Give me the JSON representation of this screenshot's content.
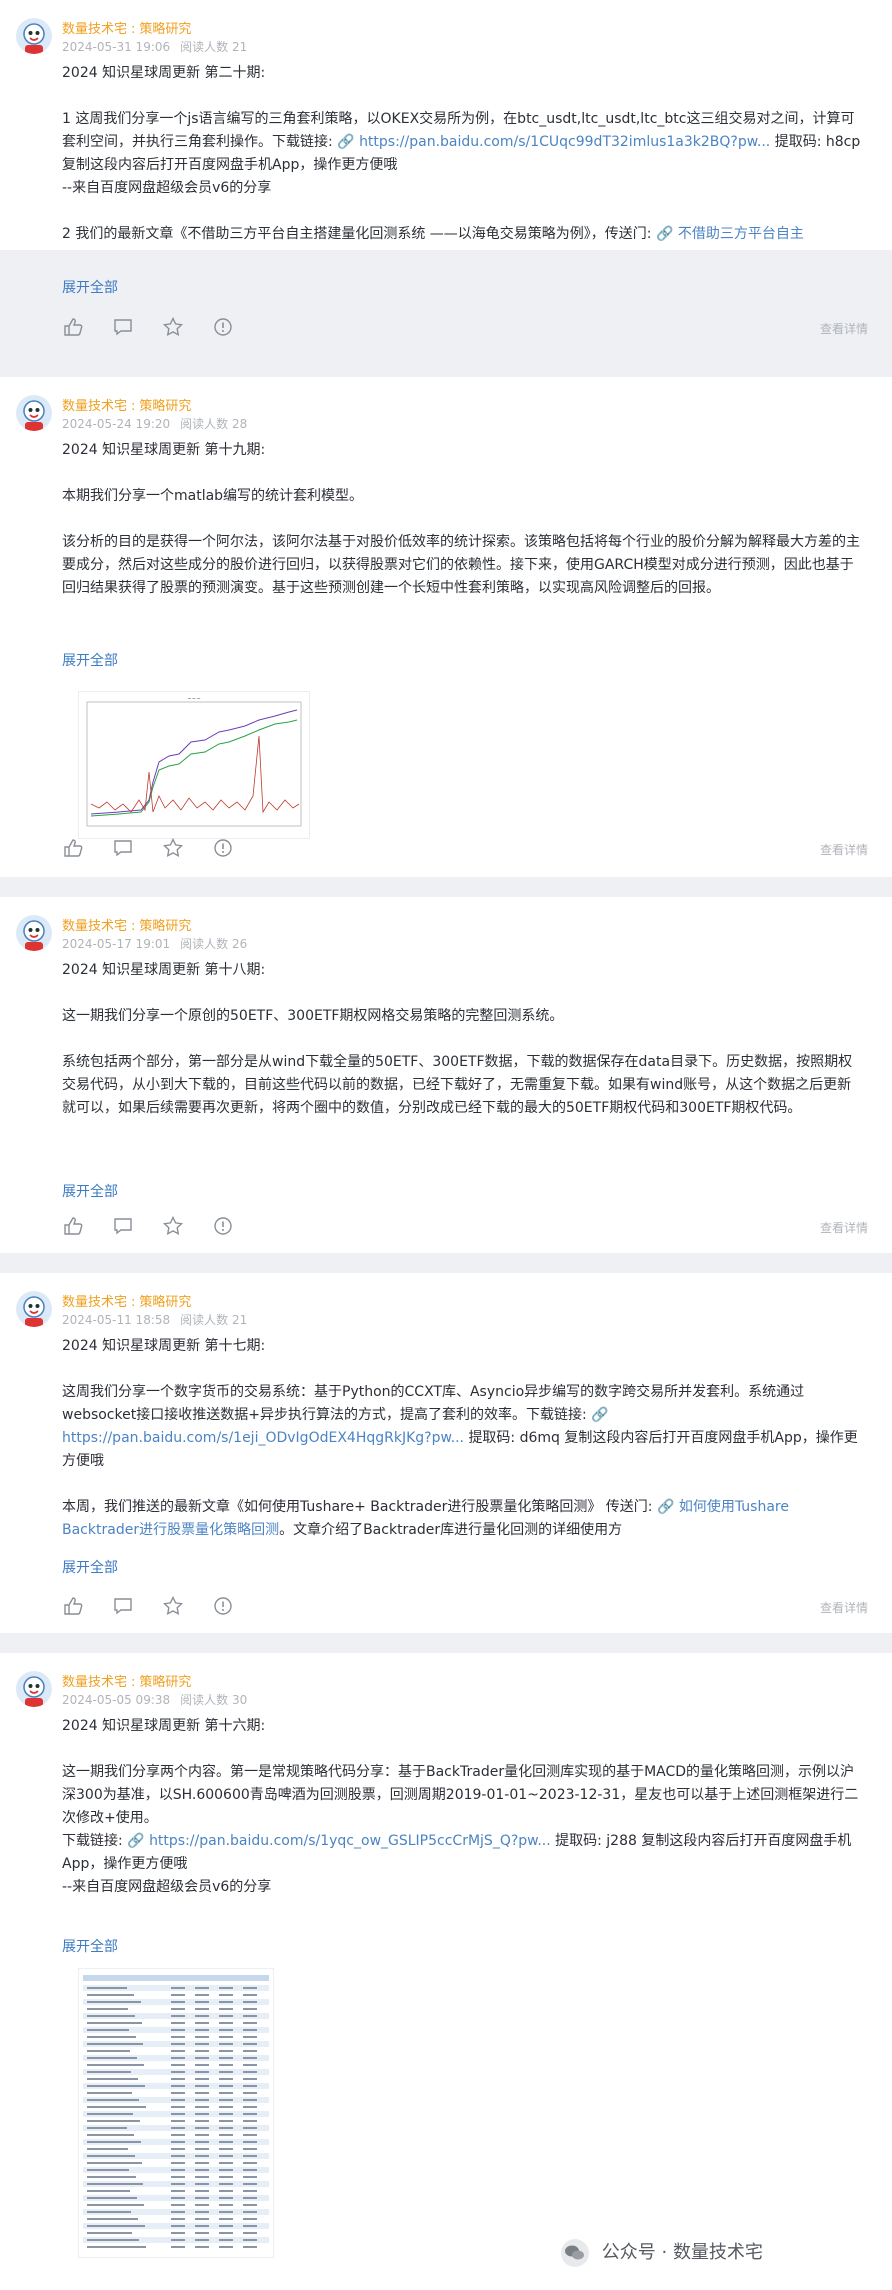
{
  "posts": [
    {
      "author": "数量技术宅",
      "tag": "策略研究",
      "date": "2024-05-31 19:06",
      "reads": "阅读人数 21",
      "expand": "展开全部",
      "detail": "查看详情",
      "p1": "2024 知识星球周更新 第二十期:",
      "p2a": "1 这周我们分享一个js语言编写的三角套利策略，以OKEX交易所为例，在btc_usdt,ltc_usdt,ltc_btc这三组交易对之间，计算可套利空间，并执行三角套利操作。下载链接:",
      "p2link": "https://pan.baidu.com/s/1CUqc99dT32imlus1a3k2BQ?pw...",
      "p2b": "提取码: h8cp 复制这段内容后打开百度网盘手机App，操作更方便哦",
      "p3": "--来自百度网盘超级会员v6的分享",
      "p4a": "2 我们的最新文章《不借助三方平台自主搭建量化回测系统 ——以海龟交易策略为例》，传送门:",
      "p4link": "不借助三方平台自主"
    },
    {
      "author": "数量技术宅",
      "tag": "策略研究",
      "date": "2024-05-24 19:20",
      "reads": "阅读人数 28",
      "expand": "展开全部",
      "detail": "查看详情",
      "p1": "2024 知识星球周更新 第十九期:",
      "p2": "本期我们分享一个matlab编写的统计套利模型。",
      "p3": "该分析的目的是获得一个阿尔法，该阿尔法基于对股价低效率的统计探索。该策略包括将每个行业的股价分解为解释最大方差的主要成分，然后对这些成分的股价进行回归，以获得股票对它们的依赖性。接下来，使用GARCH模型对成分进行预测，因此也基于回归结果获得了股票的预测演变。基于这些预测创建一个长短中性套利策略，以实现高风险调整后的回报。"
    },
    {
      "author": "数量技术宅",
      "tag": "策略研究",
      "date": "2024-05-17 19:01",
      "reads": "阅读人数 26",
      "expand": "展开全部",
      "detail": "查看详情",
      "p1": "2024 知识星球周更新 第十八期:",
      "p2": "这一期我们分享一个原创的50ETF、300ETF期权网格交易策略的完整回测系统。",
      "p3": "系统包括两个部分，第一部分是从wind下载全量的50ETF、300ETF数据，下载的数据保存在data目录下。历史数据，按照期权交易代码，从小到大下载的，目前这些代码以前的数据，已经下载好了，无需重复下载。如果有wind账号，从这个数据之后更新就可以，如果后续需要再次更新，将两个圈中的数值，分别改成已经下载的最大的50ETF期权代码和300ETF期权代码。"
    },
    {
      "author": "数量技术宅",
      "tag": "策略研究",
      "date": "2024-05-11 18:58",
      "reads": "阅读人数 21",
      "expand": "展开全部",
      "detail": "查看详情",
      "p1": "2024 知识星球周更新 第十七期:",
      "p2a": "这周我们分享一个数字货币的交易系统：基于Python的CCXT库、Asyncio异步编写的数字跨交易所并发套利。系统通过websocket接口接收推送数据+异步执行算法的方式，提高了套利的效率。下载链接:",
      "p2link": "https://pan.baidu.com/s/1eji_ODvIgOdEX4HqgRkJKg?pw...",
      "p2b": "提取码: d6mq 复制这段内容后打开百度网盘手机App，操作更方便哦",
      "p3a": "本周，我们推送的最新文章《如何使用Tushare+ Backtrader进行股票量化策略回测》 传送门:",
      "p3link": "如何使用Tushare  Backtrader进行股票量化策略回测",
      "p3b": "。文章介绍了Backtrader库进行量化回测的详细使用方"
    },
    {
      "author": "数量技术宅",
      "tag": "策略研究",
      "date": "2024-05-05 09:38",
      "reads": "阅读人数 30",
      "expand": "展开全部",
      "p1": "2024 知识星球周更新 第十六期:",
      "p2": "这一期我们分享两个内容。第一是常规策略代码分享：基于BackTrader量化回测库实现的基于MACD的量化策略回测，示例以沪深300为基准，以SH.600600青岛啤酒为回测股票，回测周期2019-01-01~2023-12-31，星友也可以基于上述回测框架进行二次修改+使用。",
      "p3a": "下载链接:",
      "p3link": "https://pan.baidu.com/s/1yqc_ow_GSLIP5ccCrMjS_Q?pw...",
      "p3b": "提取码: j288 复制这段内容后打开百度网盘手机App，操作更方便哦",
      "p4": "--来自百度网盘超级会员v6的分享"
    }
  ],
  "watermark": {
    "prefix": "公众号",
    "dot": "·",
    "name": "数量技术宅"
  },
  "colors": {
    "accent": "#f0a020",
    "link": "#3d7bc4",
    "meta": "#b0b4ba",
    "gap": "#eef0f3"
  }
}
